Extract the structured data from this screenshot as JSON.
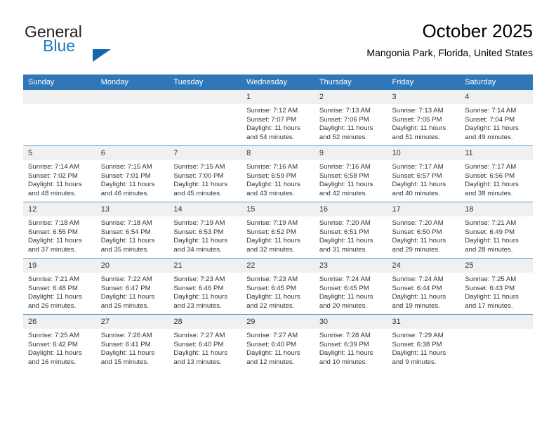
{
  "brand": {
    "word1": "General",
    "word2": "Blue",
    "triangle_color": "#1566b0",
    "blue_color": "#1a7bc4"
  },
  "header": {
    "title": "October 2025",
    "subtitle": "Mangonia Park, Florida, United States",
    "header_bar_color": "#3077b8",
    "row_line_color": "#5b9bd5",
    "daynum_band_color": "#f0f0f0"
  },
  "weekdays": [
    "Sunday",
    "Monday",
    "Tuesday",
    "Wednesday",
    "Thursday",
    "Friday",
    "Saturday"
  ],
  "weeks": [
    [
      {
        "day": "",
        "empty": true
      },
      {
        "day": "",
        "empty": true
      },
      {
        "day": "",
        "empty": true
      },
      {
        "day": "1",
        "sunrise": "Sunrise: 7:12 AM",
        "sunset": "Sunset: 7:07 PM",
        "daylight_line1": "Daylight: 11 hours",
        "daylight_line2": "and 54 minutes."
      },
      {
        "day": "2",
        "sunrise": "Sunrise: 7:13 AM",
        "sunset": "Sunset: 7:06 PM",
        "daylight_line1": "Daylight: 11 hours",
        "daylight_line2": "and 52 minutes."
      },
      {
        "day": "3",
        "sunrise": "Sunrise: 7:13 AM",
        "sunset": "Sunset: 7:05 PM",
        "daylight_line1": "Daylight: 11 hours",
        "daylight_line2": "and 51 minutes."
      },
      {
        "day": "4",
        "sunrise": "Sunrise: 7:14 AM",
        "sunset": "Sunset: 7:04 PM",
        "daylight_line1": "Daylight: 11 hours",
        "daylight_line2": "and 49 minutes."
      }
    ],
    [
      {
        "day": "5",
        "sunrise": "Sunrise: 7:14 AM",
        "sunset": "Sunset: 7:02 PM",
        "daylight_line1": "Daylight: 11 hours",
        "daylight_line2": "and 48 minutes."
      },
      {
        "day": "6",
        "sunrise": "Sunrise: 7:15 AM",
        "sunset": "Sunset: 7:01 PM",
        "daylight_line1": "Daylight: 11 hours",
        "daylight_line2": "and 46 minutes."
      },
      {
        "day": "7",
        "sunrise": "Sunrise: 7:15 AM",
        "sunset": "Sunset: 7:00 PM",
        "daylight_line1": "Daylight: 11 hours",
        "daylight_line2": "and 45 minutes."
      },
      {
        "day": "8",
        "sunrise": "Sunrise: 7:16 AM",
        "sunset": "Sunset: 6:59 PM",
        "daylight_line1": "Daylight: 11 hours",
        "daylight_line2": "and 43 minutes."
      },
      {
        "day": "9",
        "sunrise": "Sunrise: 7:16 AM",
        "sunset": "Sunset: 6:58 PM",
        "daylight_line1": "Daylight: 11 hours",
        "daylight_line2": "and 42 minutes."
      },
      {
        "day": "10",
        "sunrise": "Sunrise: 7:17 AM",
        "sunset": "Sunset: 6:57 PM",
        "daylight_line1": "Daylight: 11 hours",
        "daylight_line2": "and 40 minutes."
      },
      {
        "day": "11",
        "sunrise": "Sunrise: 7:17 AM",
        "sunset": "Sunset: 6:56 PM",
        "daylight_line1": "Daylight: 11 hours",
        "daylight_line2": "and 38 minutes."
      }
    ],
    [
      {
        "day": "12",
        "sunrise": "Sunrise: 7:18 AM",
        "sunset": "Sunset: 6:55 PM",
        "daylight_line1": "Daylight: 11 hours",
        "daylight_line2": "and 37 minutes."
      },
      {
        "day": "13",
        "sunrise": "Sunrise: 7:18 AM",
        "sunset": "Sunset: 6:54 PM",
        "daylight_line1": "Daylight: 11 hours",
        "daylight_line2": "and 35 minutes."
      },
      {
        "day": "14",
        "sunrise": "Sunrise: 7:19 AM",
        "sunset": "Sunset: 6:53 PM",
        "daylight_line1": "Daylight: 11 hours",
        "daylight_line2": "and 34 minutes."
      },
      {
        "day": "15",
        "sunrise": "Sunrise: 7:19 AM",
        "sunset": "Sunset: 6:52 PM",
        "daylight_line1": "Daylight: 11 hours",
        "daylight_line2": "and 32 minutes."
      },
      {
        "day": "16",
        "sunrise": "Sunrise: 7:20 AM",
        "sunset": "Sunset: 6:51 PM",
        "daylight_line1": "Daylight: 11 hours",
        "daylight_line2": "and 31 minutes."
      },
      {
        "day": "17",
        "sunrise": "Sunrise: 7:20 AM",
        "sunset": "Sunset: 6:50 PM",
        "daylight_line1": "Daylight: 11 hours",
        "daylight_line2": "and 29 minutes."
      },
      {
        "day": "18",
        "sunrise": "Sunrise: 7:21 AM",
        "sunset": "Sunset: 6:49 PM",
        "daylight_line1": "Daylight: 11 hours",
        "daylight_line2": "and 28 minutes."
      }
    ],
    [
      {
        "day": "19",
        "sunrise": "Sunrise: 7:21 AM",
        "sunset": "Sunset: 6:48 PM",
        "daylight_line1": "Daylight: 11 hours",
        "daylight_line2": "and 26 minutes."
      },
      {
        "day": "20",
        "sunrise": "Sunrise: 7:22 AM",
        "sunset": "Sunset: 6:47 PM",
        "daylight_line1": "Daylight: 11 hours",
        "daylight_line2": "and 25 minutes."
      },
      {
        "day": "21",
        "sunrise": "Sunrise: 7:23 AM",
        "sunset": "Sunset: 6:46 PM",
        "daylight_line1": "Daylight: 11 hours",
        "daylight_line2": "and 23 minutes."
      },
      {
        "day": "22",
        "sunrise": "Sunrise: 7:23 AM",
        "sunset": "Sunset: 6:45 PM",
        "daylight_line1": "Daylight: 11 hours",
        "daylight_line2": "and 22 minutes."
      },
      {
        "day": "23",
        "sunrise": "Sunrise: 7:24 AM",
        "sunset": "Sunset: 6:45 PM",
        "daylight_line1": "Daylight: 11 hours",
        "daylight_line2": "and 20 minutes."
      },
      {
        "day": "24",
        "sunrise": "Sunrise: 7:24 AM",
        "sunset": "Sunset: 6:44 PM",
        "daylight_line1": "Daylight: 11 hours",
        "daylight_line2": "and 19 minutes."
      },
      {
        "day": "25",
        "sunrise": "Sunrise: 7:25 AM",
        "sunset": "Sunset: 6:43 PM",
        "daylight_line1": "Daylight: 11 hours",
        "daylight_line2": "and 17 minutes."
      }
    ],
    [
      {
        "day": "26",
        "sunrise": "Sunrise: 7:25 AM",
        "sunset": "Sunset: 6:42 PM",
        "daylight_line1": "Daylight: 11 hours",
        "daylight_line2": "and 16 minutes."
      },
      {
        "day": "27",
        "sunrise": "Sunrise: 7:26 AM",
        "sunset": "Sunset: 6:41 PM",
        "daylight_line1": "Daylight: 11 hours",
        "daylight_line2": "and 15 minutes."
      },
      {
        "day": "28",
        "sunrise": "Sunrise: 7:27 AM",
        "sunset": "Sunset: 6:40 PM",
        "daylight_line1": "Daylight: 11 hours",
        "daylight_line2": "and 13 minutes."
      },
      {
        "day": "29",
        "sunrise": "Sunrise: 7:27 AM",
        "sunset": "Sunset: 6:40 PM",
        "daylight_line1": "Daylight: 11 hours",
        "daylight_line2": "and 12 minutes."
      },
      {
        "day": "30",
        "sunrise": "Sunrise: 7:28 AM",
        "sunset": "Sunset: 6:39 PM",
        "daylight_line1": "Daylight: 11 hours",
        "daylight_line2": "and 10 minutes."
      },
      {
        "day": "31",
        "sunrise": "Sunrise: 7:29 AM",
        "sunset": "Sunset: 6:38 PM",
        "daylight_line1": "Daylight: 11 hours",
        "daylight_line2": "and 9 minutes."
      },
      {
        "day": "",
        "empty": true
      }
    ]
  ]
}
